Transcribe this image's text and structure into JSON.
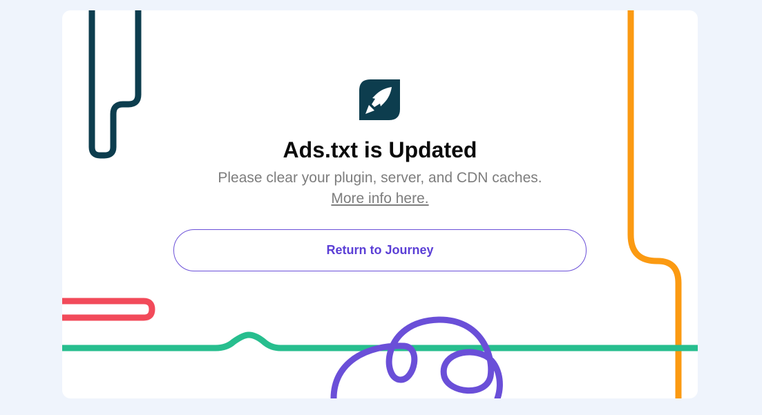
{
  "message": {
    "title": "Ads.txt is Updated",
    "subtitle": "Please clear your plugin, server, and CDN caches.",
    "more_info_link": "More info here."
  },
  "actions": {
    "return_label": "Return to Journey"
  },
  "icons": {
    "logo": "rocket-leaf-logo-icon"
  },
  "colors": {
    "page_background": "#eff4fc",
    "card_background": "#ffffff",
    "brand_dark_teal": "#0d3d4e",
    "accent_purple": "#6a4fd8",
    "line_orange": "#fb9a12",
    "line_green": "#27be8e",
    "line_red": "#f24a5a",
    "text_dark": "#0b0b0b",
    "text_muted": "#7d7d7d"
  }
}
